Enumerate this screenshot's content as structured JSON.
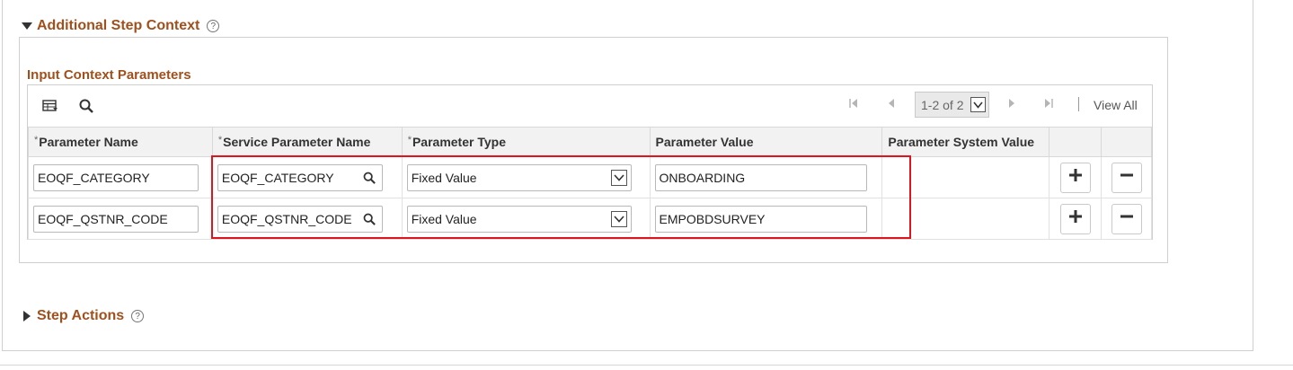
{
  "sections": {
    "additional_step_context": {
      "title": "Additional Step Context",
      "help": "?"
    },
    "step_actions": {
      "title": "Step Actions",
      "help": "?"
    }
  },
  "grid": {
    "title": "Input Context Parameters",
    "pager": {
      "range": "1-2 of 2",
      "view_all": "View All"
    },
    "required_marker": "*",
    "columns": [
      "Parameter Name",
      "Service Parameter Name",
      "Parameter Type",
      "Parameter Value",
      "Parameter System Value"
    ],
    "rows": [
      {
        "parameter_name": "EOQF_CATEGORY",
        "service_parameter_name": "EOQF_CATEGORY",
        "parameter_type": "Fixed Value",
        "parameter_value": "ONBOARDING",
        "parameter_system_value": ""
      },
      {
        "parameter_name": "EOQF_QSTNR_CODE",
        "service_parameter_name": "EOQF_QSTNR_CODE",
        "parameter_type": "Fixed Value",
        "parameter_value": "EMPOBDSURVEY",
        "parameter_system_value": ""
      }
    ]
  },
  "colors": {
    "section_title": "#a0501d",
    "highlight": "#e0141c"
  },
  "icons": [
    "chevron-down-icon",
    "chevron-right-icon",
    "help-icon",
    "personalize-grid-icon",
    "search-icon",
    "first-page-icon",
    "previous-page-icon",
    "next-page-icon",
    "last-page-icon",
    "lookup-icon",
    "dropdown-arrow-icon",
    "add-row-icon",
    "delete-row-icon"
  ]
}
